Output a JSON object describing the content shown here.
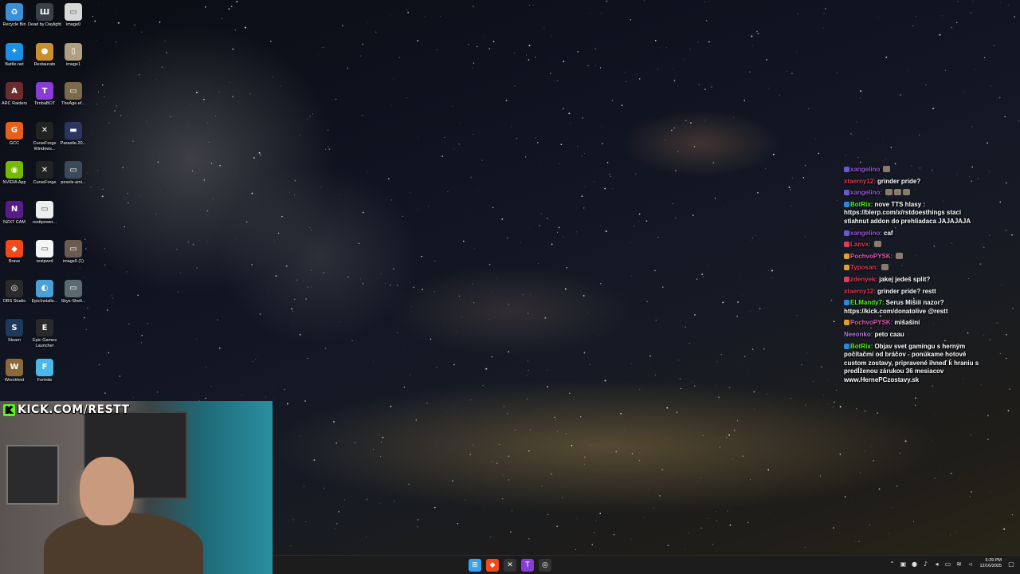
{
  "desktop": {
    "icons": [
      {
        "label": "Recycle Bin",
        "icon": "recycle-bin-icon",
        "color": "#3b8fd6",
        "glyph": "♻"
      },
      {
        "label": "Dead by Daylight",
        "icon": "dead-by-daylight-icon",
        "color": "#3a3f4a",
        "glyph": "Ш"
      },
      {
        "label": "image0",
        "icon": "image-file-icon",
        "color": "#d8d8d8",
        "glyph": "▭"
      },
      {
        "label": "Battle.net",
        "icon": "battlenet-icon",
        "color": "#1b8fe6",
        "glyph": "✦"
      },
      {
        "label": "Restaurats",
        "icon": "restaurats-icon",
        "color": "#c8902a",
        "glyph": "●"
      },
      {
        "label": "image1",
        "icon": "image-file-icon",
        "color": "#b0a080",
        "glyph": "▯"
      },
      {
        "label": "ARC Raiders",
        "icon": "arc-raiders-icon",
        "color": "#6a2c2c",
        "glyph": "A"
      },
      {
        "label": "TimbaBOT",
        "icon": "timbabot-icon",
        "color": "#8a3cd6",
        "glyph": "T"
      },
      {
        "label": "TheAge.ef...",
        "icon": "image-file-icon",
        "color": "#7a6a4a",
        "glyph": "▭"
      },
      {
        "label": "GCC",
        "icon": "gcc-icon",
        "color": "#e4601c",
        "glyph": "G"
      },
      {
        "label": "CurseForge Windows...",
        "icon": "curseforge-icon",
        "color": "#222222",
        "glyph": "✕"
      },
      {
        "label": "Parasite.20...",
        "icon": "video-file-icon",
        "color": "#2a3560",
        "glyph": "▬"
      },
      {
        "label": "NVIDIA App",
        "icon": "nvidia-icon",
        "color": "#76b900",
        "glyph": "◉"
      },
      {
        "label": "CurseForge",
        "icon": "curseforge-icon",
        "color": "#222222",
        "glyph": "✕"
      },
      {
        "label": "pexels-ami...",
        "icon": "image-file-icon",
        "color": "#3a4a5a",
        "glyph": "▭"
      },
      {
        "label": "NZXT CAM",
        "icon": "nzxt-cam-icon",
        "color": "#5a1a8a",
        "glyph": "N"
      },
      {
        "label": "resttpower...",
        "icon": "image-file-icon",
        "color": "#eeeeee",
        "glyph": "▭"
      },
      {
        "label": "",
        "icon": "blank-icon",
        "color": "transparent",
        "glyph": ""
      },
      {
        "label": "Brave",
        "icon": "brave-icon",
        "color": "#f04a1a",
        "glyph": "◆"
      },
      {
        "label": "restpwrd",
        "icon": "image-file-icon",
        "color": "#f4f4f4",
        "glyph": "▭"
      },
      {
        "label": "image0 (1)",
        "icon": "image-file-icon",
        "color": "#6a5a50",
        "glyph": "▭"
      },
      {
        "label": "OBS Studio",
        "icon": "obs-icon",
        "color": "#2a2a2a",
        "glyph": "◎"
      },
      {
        "label": "EpicInstalle...",
        "icon": "installer-icon",
        "color": "#4aa0d8",
        "glyph": "◐"
      },
      {
        "label": "Skys-Shelt...",
        "icon": "image-file-icon",
        "color": "#5a6a70",
        "glyph": "▭"
      },
      {
        "label": "Steam",
        "icon": "steam-icon",
        "color": "#1b3a5c",
        "glyph": "S"
      },
      {
        "label": "Epic Games Launcher",
        "icon": "epic-games-icon",
        "color": "#2a2a2a",
        "glyph": "E"
      },
      {
        "label": "",
        "icon": "blank-icon",
        "color": "transparent",
        "glyph": ""
      },
      {
        "label": "Wreckfest",
        "icon": "wreckfest-icon",
        "color": "#8a6a3a",
        "glyph": "W"
      },
      {
        "label": "Fortnite",
        "icon": "fortnite-icon",
        "color": "#4ab8e8",
        "glyph": "F"
      }
    ]
  },
  "kick_banner": {
    "text": "KICK.COM/RESTT",
    "logo": "K",
    "color": "#53fc18"
  },
  "chat": {
    "messages": [
      {
        "user": "xangelino",
        "user_color": "#9b59d0",
        "badge": "#6a5acd",
        "text": "",
        "emotes": 1
      },
      {
        "user": "xtaerny12:",
        "user_color": "#e03c5a",
        "badge": "",
        "text": "grinder pride?",
        "emotes": 0
      },
      {
        "user": "xangelino:",
        "user_color": "#9b59d0",
        "badge": "#6a5acd",
        "text": "",
        "emotes": 3
      },
      {
        "user": "BotRix:",
        "user_color": "#53fc18",
        "badge": "#2e86de",
        "text": "nove TTS hlasy : https://blerp.com/x/rstdoesthings staci stiahnut addon do prehliadaca JAJAJAJA",
        "emotes": 0
      },
      {
        "user": "xangelino:",
        "user_color": "#9b59d0",
        "badge": "#6a5acd",
        "text": "caf",
        "emotes": 0
      },
      {
        "user": "Lanvx:",
        "user_color": "#e03c5a",
        "badge": "#e03c5a",
        "text": "",
        "emotes": 1
      },
      {
        "user": "PochvoPYSK:",
        "user_color": "#e05ab0",
        "badge": "#e0a030",
        "text": "",
        "emotes": 1
      },
      {
        "user": "Typosan:",
        "user_color": "#e03c5a",
        "badge": "#e0a030",
        "text": "",
        "emotes": 1
      },
      {
        "user": "zdenyek:",
        "user_color": "#e03c5a",
        "badge": "#e03c5a",
        "text": "jakej jedeš split?",
        "emotes": 0
      },
      {
        "user": "xtaerny12:",
        "user_color": "#e03c5a",
        "badge": "",
        "text": "grinder pride? restt",
        "emotes": 0
      },
      {
        "user": "ELMandy7:",
        "user_color": "#53fc18",
        "badge": "#2e86de",
        "text": "Serus Mišiii nazor? https://kick.com/donatolive @restt",
        "emotes": 0
      },
      {
        "user": "PochvoPYSK:",
        "user_color": "#e05ab0",
        "badge": "#e0a030",
        "text": "mišašini",
        "emotes": 0
      },
      {
        "user": "Neeonko:",
        "user_color": "#b07ae0",
        "badge": "",
        "text": "peto caau",
        "emotes": 0
      },
      {
        "user": "BotRix:",
        "user_color": "#53fc18",
        "badge": "#2e86de",
        "text": "Objav svet gamingu s herným počítačmi od bráčov - ponúkame hotové custom zostavy, pripravené ihneď k hraniu s predĺženou zárukou 36 mesiacov www.HernePCzostavy.sk",
        "emotes": 0
      }
    ]
  },
  "taskbar": {
    "apps": [
      {
        "name": "start-button",
        "glyph": "⊞",
        "color": "#3aa0f0"
      },
      {
        "name": "brave-taskbar-button",
        "glyph": "◆",
        "color": "#f04a1a"
      },
      {
        "name": "curseforge-taskbar-button",
        "glyph": "✕",
        "color": "#333333"
      },
      {
        "name": "timbabot-taskbar-button",
        "glyph": "T",
        "color": "#8a3cd6"
      },
      {
        "name": "obs-taskbar-button",
        "glyph": "◎",
        "color": "#333333"
      }
    ],
    "tray": [
      {
        "name": "chevron-up-icon",
        "glyph": "⌃"
      },
      {
        "name": "folder-icon",
        "glyph": "▣"
      },
      {
        "name": "app-tray-icon",
        "glyph": "●"
      },
      {
        "name": "microphone-icon",
        "glyph": "♪"
      },
      {
        "name": "speaker-icon",
        "glyph": "◂"
      },
      {
        "name": "monitor-icon",
        "glyph": "▭"
      },
      {
        "name": "network-icon",
        "glyph": "≋"
      },
      {
        "name": "volume-icon",
        "glyph": "◃"
      }
    ],
    "time": "6:29 PM",
    "date": "12/16/2025"
  }
}
